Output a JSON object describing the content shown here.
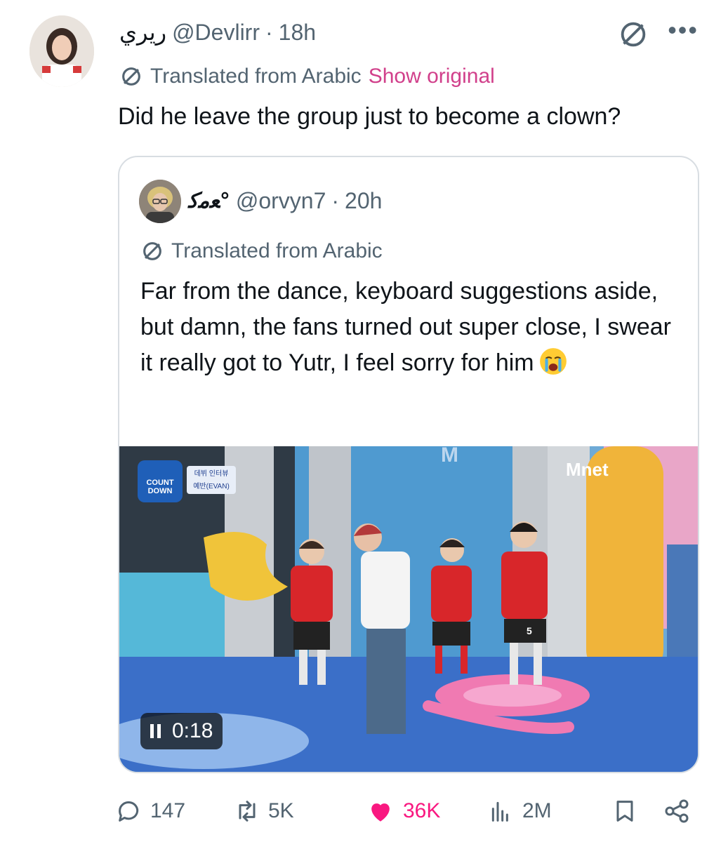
{
  "tweet": {
    "display_name": "ريري",
    "handle": "@Devlirr",
    "separator": "·",
    "time": "18h",
    "translated_label": "Translated from Arabic",
    "show_original": "Show original",
    "text": "Did he leave the group just to become a clown?"
  },
  "quote": {
    "display_name": "ﻌﻣﮐ°",
    "handle": "@orvyn7",
    "separator": "·",
    "time": "20h",
    "translated_label": "Translated from Arabic",
    "text": "Far from the dance, keyboard suggestions aside, but damn, the fans turned out super close, I swear it really got to Yutr, I feel sorry for him",
    "video": {
      "timestamp": "0:18",
      "logo_left": "COUNT DOWN",
      "caption_korean_1": "데뷔 인터뷰",
      "caption_korean_2": "예반(EVAN)",
      "logo_right": "Mnet",
      "jersey_number": "5"
    }
  },
  "actions": {
    "replies": "147",
    "reposts": "5K",
    "likes": "36K",
    "views": "2M"
  },
  "colors": {
    "accent_pink": "#d1408b",
    "like_pink": "#f91880",
    "muted": "#536471"
  },
  "icons": [
    "translate-icon",
    "more-icon",
    "reply-icon",
    "repost-icon",
    "like-icon",
    "views-icon",
    "bookmark-icon",
    "share-icon",
    "pause-icon"
  ]
}
